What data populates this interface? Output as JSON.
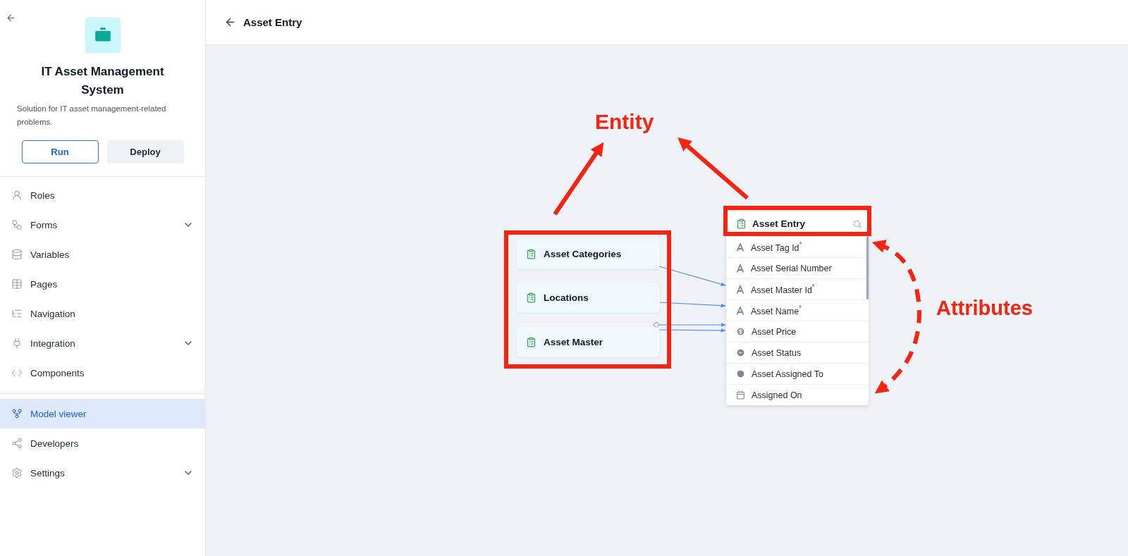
{
  "sidebar": {
    "app_title": "IT Asset Management System",
    "app_description": "Solution for IT asset management-related problems.",
    "buttons": [
      {
        "label": "Run",
        "kind": "outline"
      },
      {
        "label": "Deploy",
        "kind": "filled"
      }
    ],
    "nav_items": [
      {
        "label": "Roles",
        "expandable": false,
        "selected": false
      },
      {
        "label": "Forms",
        "expandable": true,
        "selected": false
      },
      {
        "label": "Variables",
        "expandable": false,
        "selected": false
      },
      {
        "label": "Pages",
        "expandable": false,
        "selected": false
      },
      {
        "label": "Navigation",
        "expandable": false,
        "selected": false
      },
      {
        "label": "Integration",
        "expandable": true,
        "selected": false
      },
      {
        "label": "Components",
        "expandable": false,
        "selected": false
      }
    ],
    "nav_items_secondary": [
      {
        "label": "Model viewer",
        "expandable": false,
        "selected": true
      },
      {
        "label": "Developers",
        "expandable": false,
        "selected": false
      },
      {
        "label": "Settings",
        "expandable": true,
        "selected": false
      }
    ]
  },
  "header": {
    "title": "Asset Entry"
  },
  "diagram": {
    "related_entities": [
      "Asset Categories",
      "Locations",
      "Asset Master"
    ],
    "entity": {
      "title": "Asset Entry",
      "attributes": [
        {
          "name": "Asset Tag Id$^{*}$",
          "kind": "text"
        },
        {
          "name": "Asset Serial Number",
          "kind": "text"
        },
        {
          "name": "Asset Master Id$^{*}$",
          "kind": "text"
        },
        {
          "name": "Asset Name$^{*}$",
          "kind": "text"
        },
        {
          "name": "Asset Price",
          "kind": "currency"
        },
        {
          "name": "Asset Status",
          "kind": "choice"
        },
        {
          "name": "Asset Assigned To",
          "kind": "user"
        },
        {
          "name": "Assigned On",
          "kind": "date"
        }
      ]
    },
    "annotations": [
      {
        "text": "Entity",
        "kind": "entity"
      },
      {
        "text": "Attributes",
        "kind": "attributes"
      }
    ]
  }
}
